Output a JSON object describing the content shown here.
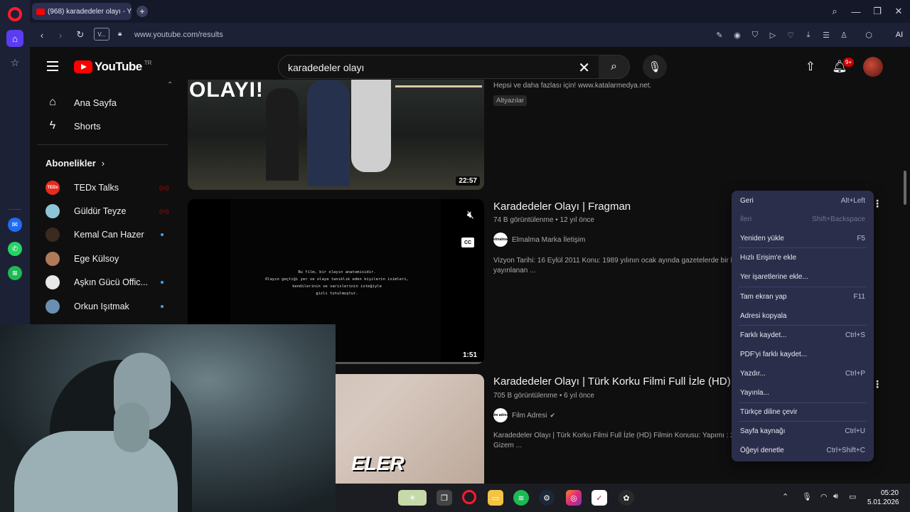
{
  "browser": {
    "tab_title": "(968) karadedeler olayı - Y",
    "url": "www.youtube.com/results",
    "url_badge": "V...",
    "ai_label": "AI"
  },
  "youtube": {
    "logo_text": "YouTube",
    "country_code": "TR",
    "search_query": "karadedeler olayı",
    "notification_badge": "9+",
    "nav": [
      {
        "label": "Ana Sayfa",
        "icon": "home-icon"
      },
      {
        "label": "Shorts",
        "icon": "shorts-icon"
      }
    ],
    "subscriptions_title": "Abonelikler",
    "subscriptions": [
      {
        "name": "TEDx Talks",
        "avatar_text": "TEDx",
        "color": "#e62b1e",
        "indicator": "live"
      },
      {
        "name": "Güldür Teyze",
        "avatar_text": "",
        "color": "#8ec5d6",
        "indicator": "live"
      },
      {
        "name": "Kemal Can Hazer",
        "avatar_text": "",
        "color": "#3b2a22",
        "indicator": "new"
      },
      {
        "name": "Ege Külsoy",
        "avatar_text": "",
        "color": "#b07a5a",
        "indicator": ""
      },
      {
        "name": "Aşkın Gücü Offic...",
        "avatar_text": "",
        "color": "#e8e8e8",
        "indicator": "new"
      },
      {
        "name": "Orkun Işıtmak",
        "avatar_text": "",
        "color": "#6b8fb0",
        "indicator": "new"
      }
    ],
    "results": [
      {
        "thumb_text": "OLAYI!",
        "duration": "22:57",
        "desc": "Hepsi ve daha fazlası için! www.katalarmedya.net.",
        "chip": "Altyazılar"
      },
      {
        "title": "Karadedeler Olayı | Fragman",
        "views": "74 B görüntülenme",
        "age": "12 yıl önce",
        "channel": "Elmalma Marka İletişim",
        "channel_av": "elmalma",
        "desc": "Vizyon Tarihi: 16 Eylül 2011 Konu: 1989 yılının ocak ayında gazetelerde bir k",
        "desc2": "yayınlanan ...",
        "duration": "1:51",
        "thumb_lines": [
          "Bu film, bir olayın anatomisidir.",
          "Olayın geçtiği yer ve olaya tanıklık eden kişilerin isimleri,",
          "kendilerinin ve varislerinin isteğiyle",
          "gizli tutulmuştur."
        ]
      },
      {
        "title": "Karadedeler Olayı | Türk Korku Filmi Full İzle (HD)",
        "views": "705 B görüntülenme",
        "age": "6 yıl önce",
        "channel": "Film Adresi",
        "channel_av": "film adresi",
        "desc": "Karadedeler Olayı | Türk Korku Filmi Full İzle (HD) Filmin Konusu: Yapımı : 2",
        "desc2": "Gizem ...",
        "thumb_text": "ELER"
      }
    ]
  },
  "context_menu": [
    {
      "label": "Geri",
      "shortcut": "Alt+Left",
      "disabled": false
    },
    {
      "label": "İleri",
      "shortcut": "Shift+Backspace",
      "disabled": true
    },
    {
      "label": "Yeniden yükle",
      "shortcut": "F5",
      "disabled": false
    },
    {
      "label": "Hızlı Erişim'e ekle",
      "shortcut": "",
      "disabled": false
    },
    {
      "label": "Yer işaretlerine ekle...",
      "shortcut": "",
      "disabled": false
    },
    {
      "label": "Tam ekran yap",
      "shortcut": "F11",
      "disabled": false
    },
    {
      "label": "Adresi kopyala",
      "shortcut": "",
      "disabled": false
    },
    {
      "label": "Farklı kaydet...",
      "shortcut": "Ctrl+S",
      "disabled": false
    },
    {
      "label": "PDF'yi farklı kaydet...",
      "shortcut": "",
      "disabled": false
    },
    {
      "label": "Yazdır...",
      "shortcut": "Ctrl+P",
      "disabled": false
    },
    {
      "label": "Yayınla...",
      "shortcut": "",
      "disabled": false
    },
    {
      "label": "Türkçe diline çevir",
      "shortcut": "",
      "disabled": false
    },
    {
      "label": "Sayfa kaynağı",
      "shortcut": "Ctrl+U",
      "disabled": false
    },
    {
      "label": "Öğeyi denetle",
      "shortcut": "Ctrl+Shift+C",
      "disabled": false
    }
  ],
  "taskbar": {
    "time": "05:20",
    "date": "5.01.2026"
  },
  "colors": {
    "opera_red": "#ff1b2d",
    "youtube_red": "#ff0000",
    "menu_bg": "#2b2e4a"
  }
}
